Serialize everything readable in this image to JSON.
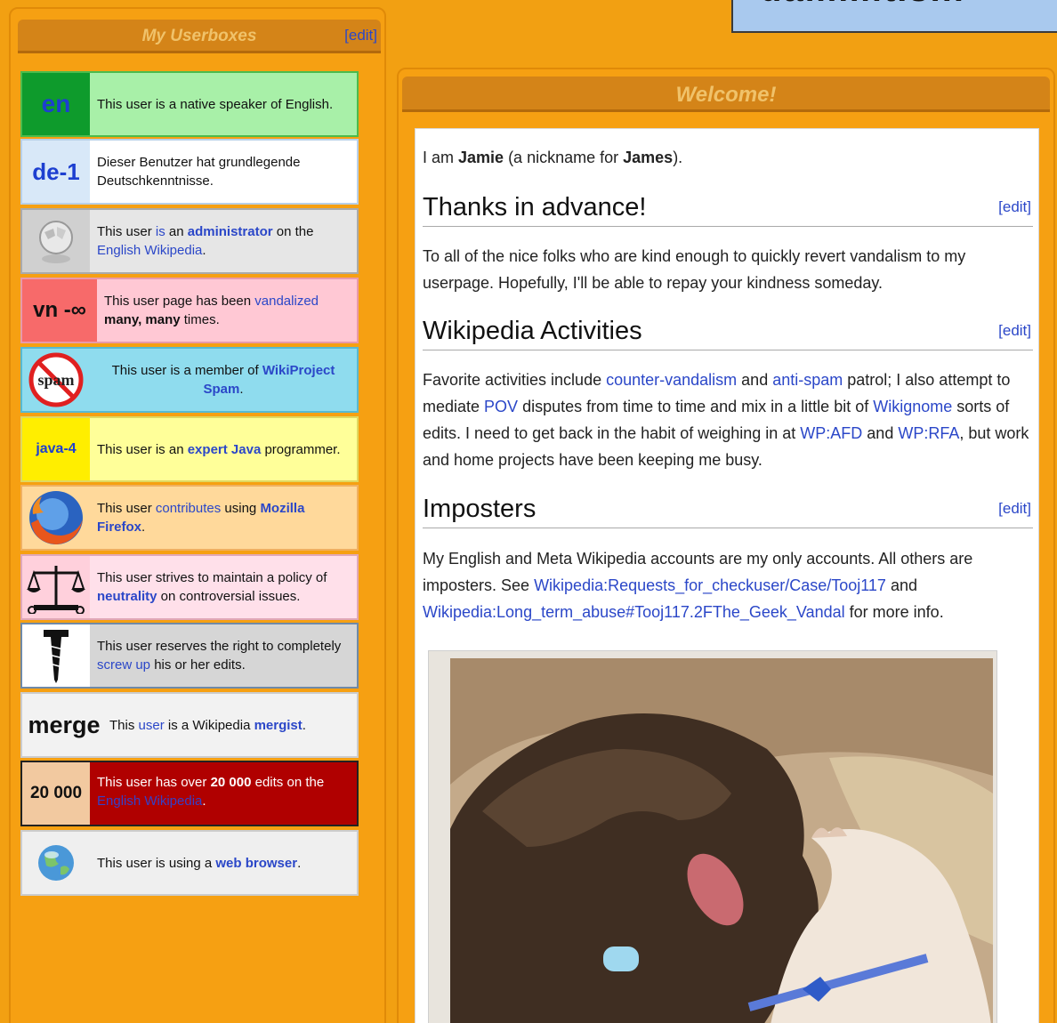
{
  "top_box": {
    "text": "dammit.s..."
  },
  "userboxes": {
    "title": "My Userboxes",
    "edit": "[edit]",
    "items": [
      {
        "code": "en",
        "text": "This user is a native speaker of English."
      },
      {
        "code": "de-1",
        "text": "Dieser Benutzer hat grundlegende Deutschkenntnisse."
      },
      {
        "icon": "wikipedia-globe-icon",
        "pre": "This user ",
        "link1": "is",
        "mid1": " an ",
        "link2": "administrator",
        "mid2": " on the ",
        "link3": "English Wikipedia",
        "post": "."
      },
      {
        "code": "vn -∞",
        "pre": "This user page has been ",
        "link1": "vandalized",
        "bold": "many, many",
        "post": " times."
      },
      {
        "icon": "no-spam-icon",
        "icon_text": "spam",
        "pre": "This user is a member of ",
        "link1": "WikiProject Spam",
        "post": "."
      },
      {
        "code": "java-4",
        "pre": "This user is an ",
        "link1": "expert",
        "bold": "Java",
        "post": " programmer."
      },
      {
        "icon": "firefox-icon",
        "pre": "This user ",
        "link1": "contributes",
        "mid1": " using ",
        "link2": "Mozilla Firefox",
        "post": "."
      },
      {
        "icon": "scales-icon",
        "pre": "This user strives to maintain a policy of ",
        "link1": "neutrality",
        "post": " on controversial issues."
      },
      {
        "icon": "screw-icon",
        "pre": "This user reserves the right to completely ",
        "link1": "screw up",
        "post": " his or her edits."
      },
      {
        "code": "merge",
        "pre": "This ",
        "link1": "user",
        "mid1": " is a Wikipedia ",
        "link2": "mergist",
        "post": "."
      },
      {
        "code": "20 000",
        "pre": "This user has over ",
        "bold": "20 000",
        "mid1": " edits on the ",
        "link1": "English Wikipedia",
        "post": "."
      },
      {
        "icon": "globe-browser-icon",
        "pre": "This user is using a ",
        "link1": "web browser",
        "post": "."
      }
    ]
  },
  "welcome": {
    "title": "Welcome!",
    "intro_pre": "I am ",
    "intro_name": "Jamie",
    "intro_mid": " (a nickname for ",
    "intro_name2": "James",
    "intro_post": ").",
    "sections": [
      {
        "heading": "Thanks in advance!",
        "edit": "[edit]",
        "text": "To all of the nice folks who are kind enough to quickly revert vandalism to my userpage. Hopefully, I'll be able to repay your kindness someday."
      },
      {
        "heading": "Wikipedia Activities",
        "edit": "[edit]",
        "p1": "Favorite activities include ",
        "l1": "counter-vandalism",
        "p2": " and ",
        "l2": "anti-spam",
        "p3": " patrol; I also attempt to mediate ",
        "l3": "POV",
        "p4": " disputes from time to time and mix in a little bit of ",
        "l4": "Wikignome",
        "p5": " sorts of edits. I need to get back in the habit of weighing in at ",
        "l5": "WP:AFD",
        "p6": " and ",
        "l6": "WP:RFA",
        "p7": ", but work and home projects have been keeping me busy."
      },
      {
        "heading": "Imposters",
        "edit": "[edit]",
        "p1": "My English and Meta Wikipedia accounts are my only accounts. All others are imposters. See ",
        "l1": "Wikipedia:Requests_for_checkuser/Case/Tooj117",
        "p2": " and ",
        "l2": "Wikipedia:Long_term_abuse#Tooj117.2FThe_Geek_Vandal",
        "p3": " for more info."
      }
    ]
  },
  "colors": {
    "page_bg": "#f2a012",
    "header_bar": "#d48418",
    "link": "#2b47c8"
  }
}
